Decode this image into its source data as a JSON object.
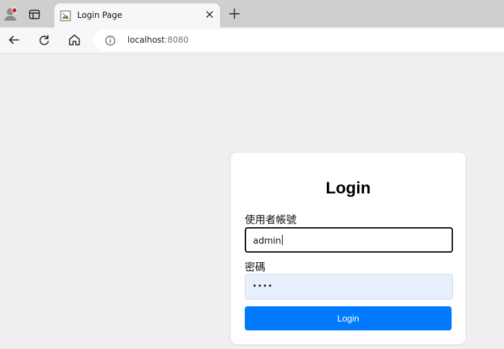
{
  "browser": {
    "tab": {
      "title": "Login Page",
      "favicon_icon": "image-favicon-icon",
      "close_icon": "close-icon"
    },
    "toolbar": {
      "back_icon": "back-arrow-icon",
      "reload_icon": "reload-icon",
      "home_icon": "home-icon",
      "info_icon": "info-icon",
      "url_host": "localhost",
      "url_port": ":8080"
    },
    "new_tab_icon": "plus-icon",
    "profile_icon": "profile-icon",
    "notification_color": "#d71a1a"
  },
  "login": {
    "title": "Login",
    "username_label": "使用者帳號",
    "username_value": "admin",
    "password_label": "密碼",
    "password_value": "••••",
    "button_label": "Login"
  },
  "colors": {
    "page_background": "#efefef",
    "card_background": "#ffffff",
    "primary_button": "#007bff",
    "autofill_background": "#e8f0fe"
  }
}
